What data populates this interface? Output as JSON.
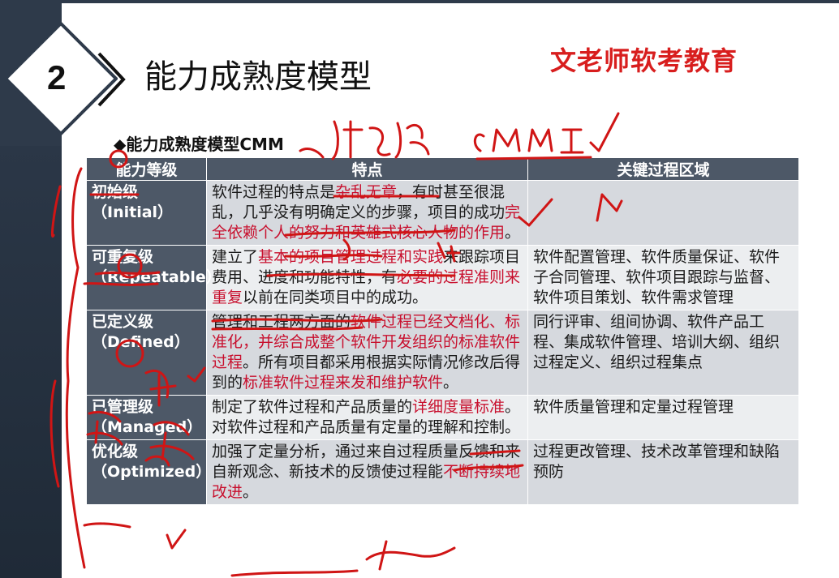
{
  "slide": {
    "number": "2",
    "title": "能力成熟度模型",
    "brand": "文老师软考教育"
  },
  "subtitle": "◆能力成熟度模型CMM",
  "table": {
    "headers": [
      "能力等级",
      "特点",
      "关键过程区域"
    ],
    "rows": [
      {
        "level": "初始级（Initial）",
        "feature": [
          {
            "t": "软件过程的特点是"
          },
          {
            "t": "杂乱无章",
            "h": true
          },
          {
            "t": "，有时甚至很混乱，几乎没有明确定义的步骤，项目的成功"
          },
          {
            "t": "完全依赖个人的努力和英雄式核心人物的作用",
            "h": true
          },
          {
            "t": "。"
          }
        ],
        "area": ""
      },
      {
        "level": "可重复级（Repeatable）",
        "feature": [
          {
            "t": "建立了"
          },
          {
            "t": "基本的项目管理过程和实践",
            "h": true
          },
          {
            "t": "来跟踪项目费用、进度和功能特性，有"
          },
          {
            "t": "必要的过程准则来重复",
            "h": true
          },
          {
            "t": "以前在同类项目中的成功。"
          }
        ],
        "area": "软件配置管理、软件质量保证、软件子合同管理、软件项目跟踪与监督、软件项目策划、软件需求管理"
      },
      {
        "level": "已定义级（Defined）",
        "feature": [
          {
            "t": "管理和工程两方面的"
          },
          {
            "t": "软件过程已经文档化、标准化，并综合成整个软件开发组织的标准软件过程",
            "h": true
          },
          {
            "t": "。所有项目都采用根据实际情况修改后得到的"
          },
          {
            "t": "标准软件过程来发和维护软件",
            "h": true
          },
          {
            "t": "。"
          }
        ],
        "area": "同行评审、组间协调、软件产品工程、集成软件管理、培训大纲、组织过程定义、组织过程集点"
      },
      {
        "level": "已管理级（Managed）",
        "feature": [
          {
            "t": "制定了软件过程和产品质量的"
          },
          {
            "t": "详细度量标准",
            "h": true
          },
          {
            "t": "。对软件过程和产品质量有定量的理解和控制。"
          }
        ],
        "area": "软件质量管理和定量过程管理"
      },
      {
        "level": "优化级（Optimized）",
        "feature": [
          {
            "t": "加强了定量分析，通过来自过程质量反馈和来自新观念、新技术的反馈使过程能"
          },
          {
            "t": "不断持续地改进",
            "h": true
          },
          {
            "t": "。"
          }
        ],
        "area": "过程更改管理、技术改革管理和缺陷预防"
      }
    ]
  },
  "colors": {
    "accent": "#d81e1e",
    "header_bg": "#4d5867",
    "ink": "#d01515"
  }
}
